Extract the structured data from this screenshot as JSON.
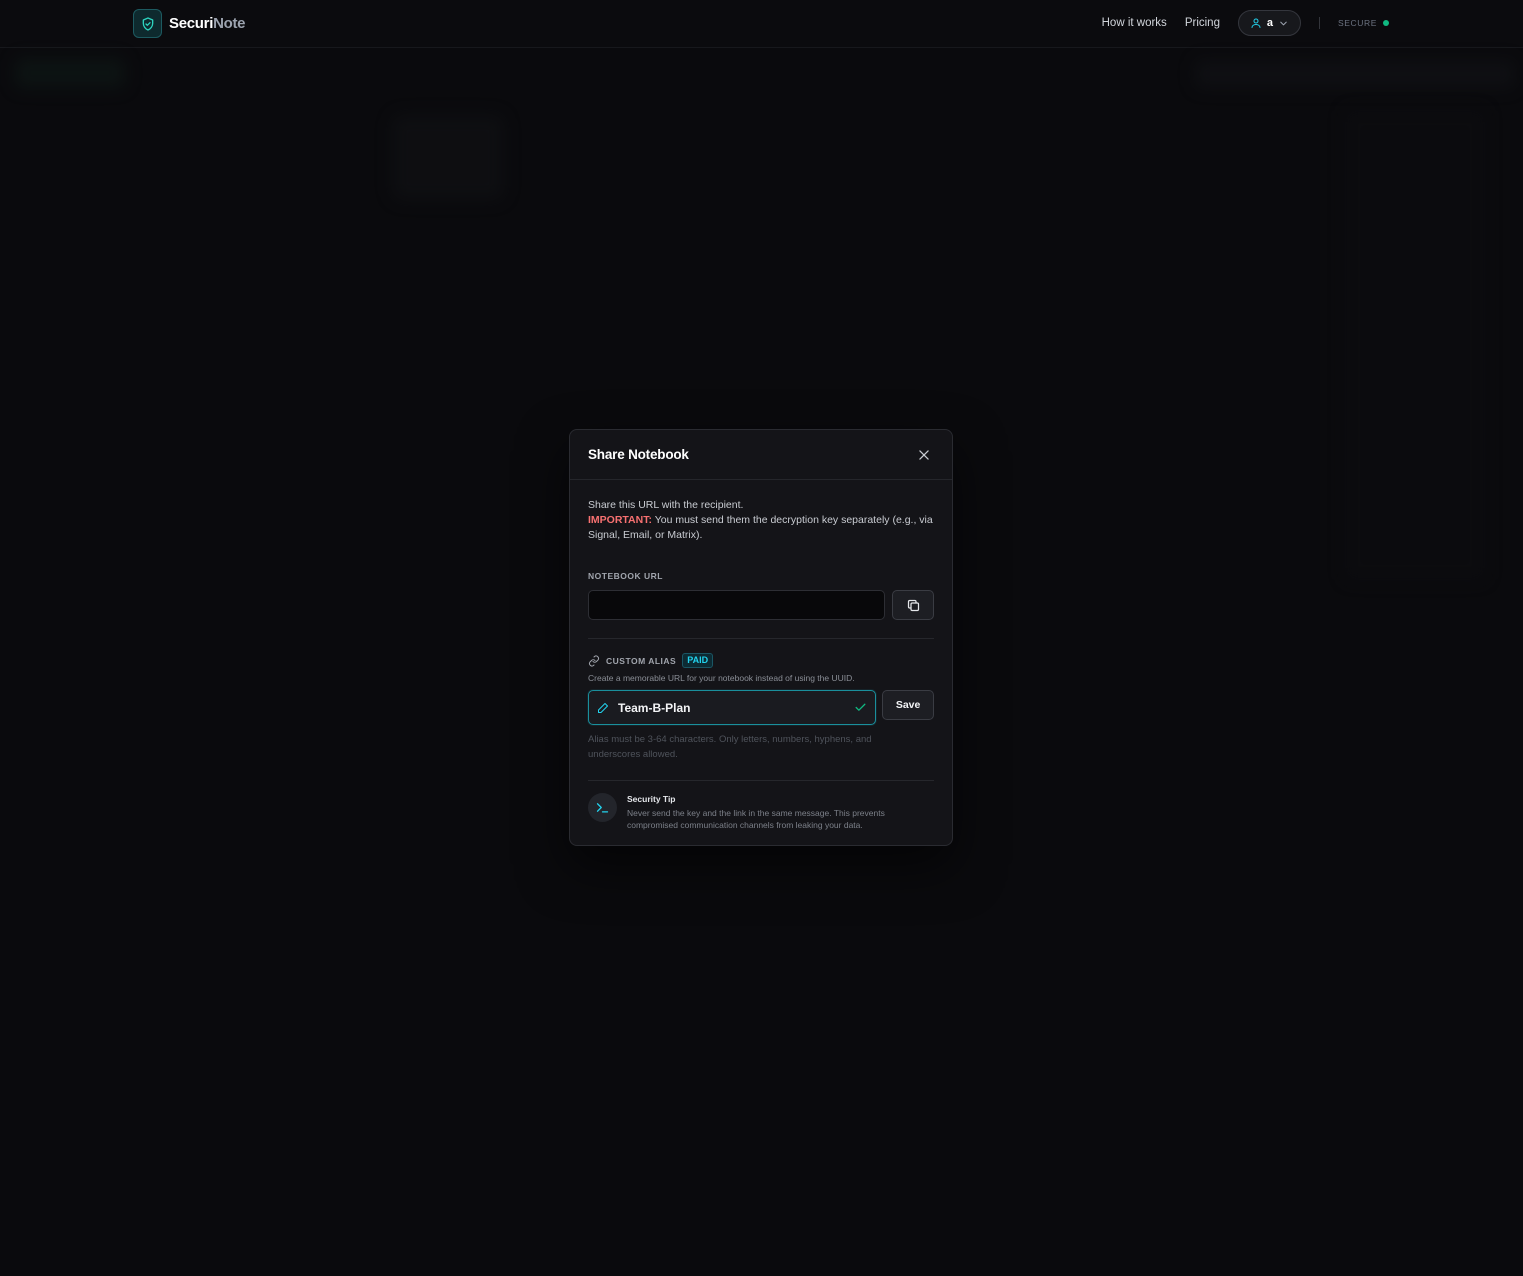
{
  "brand": {
    "name_part1": "Securi",
    "name_part2": "Note"
  },
  "nav": {
    "how_it_works": "How it works",
    "pricing": "Pricing",
    "user_initial": "a",
    "status_label": "SECURE"
  },
  "modal": {
    "title": "Share Notebook",
    "intro_line1": "Share this URL with the recipient.",
    "important_label": "IMPORTANT:",
    "important_text": " You must send them the decryption key separately (e.g., via Signal, Email, or Matrix).",
    "url_label": "NOTEBOOK URL",
    "url_value": "",
    "alias": {
      "label": "CUSTOM ALIAS",
      "badge": "PAID",
      "help": "Create a memorable URL for your notebook instead of using the UUID.",
      "value": "Team-B-Plan",
      "save_label": "Save",
      "rule": "Alias must be 3-64 characters. Only letters, numbers, hyphens, and underscores allowed."
    },
    "tip": {
      "title": "Security Tip",
      "text": "Never send the key and the link in the same message. This prevents compromised communication channels from leaking your data."
    }
  },
  "colors": {
    "accent": "#22d3ee",
    "important": "#f87171",
    "secure_dot": "#10b981",
    "background": "#0a0a0d"
  }
}
